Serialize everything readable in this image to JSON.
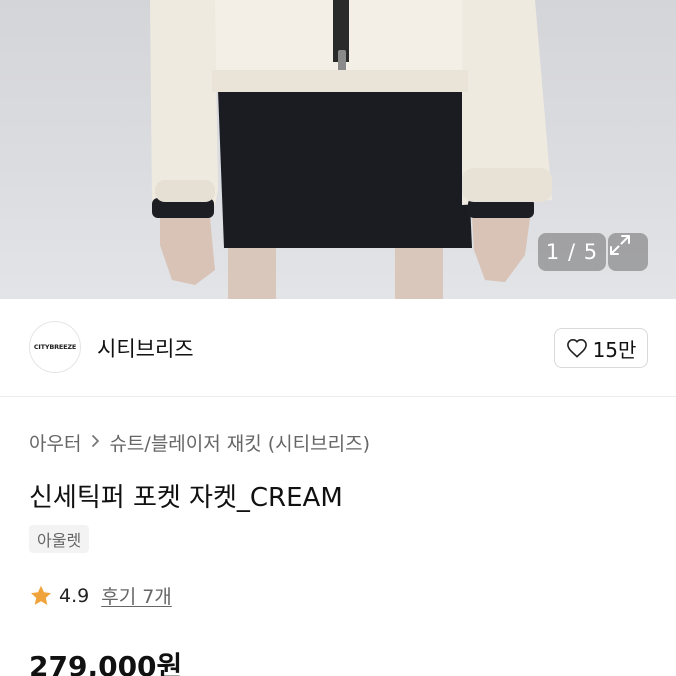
{
  "hero": {
    "image_counter": "1 / 5",
    "expand_icon": "expand-arrows-icon"
  },
  "seller": {
    "logo_text": "CITYBREEZE",
    "name": "시티브리즈",
    "like_icon": "heart-outline-icon",
    "like_count": "15만"
  },
  "breadcrumb": {
    "category": "아우터",
    "separator_icon": "chevron-right-icon",
    "subcategory": "슈트/블레이저 재킷 (시티브리즈)"
  },
  "product": {
    "title": "신세틱퍼 포켓 자켓_CREAM",
    "tag": "아울렛",
    "rating_icon": "star-icon",
    "rating_color": "#f0a33a",
    "rating": "4.9",
    "reviews": "후기 7개",
    "price": "279,000원"
  }
}
